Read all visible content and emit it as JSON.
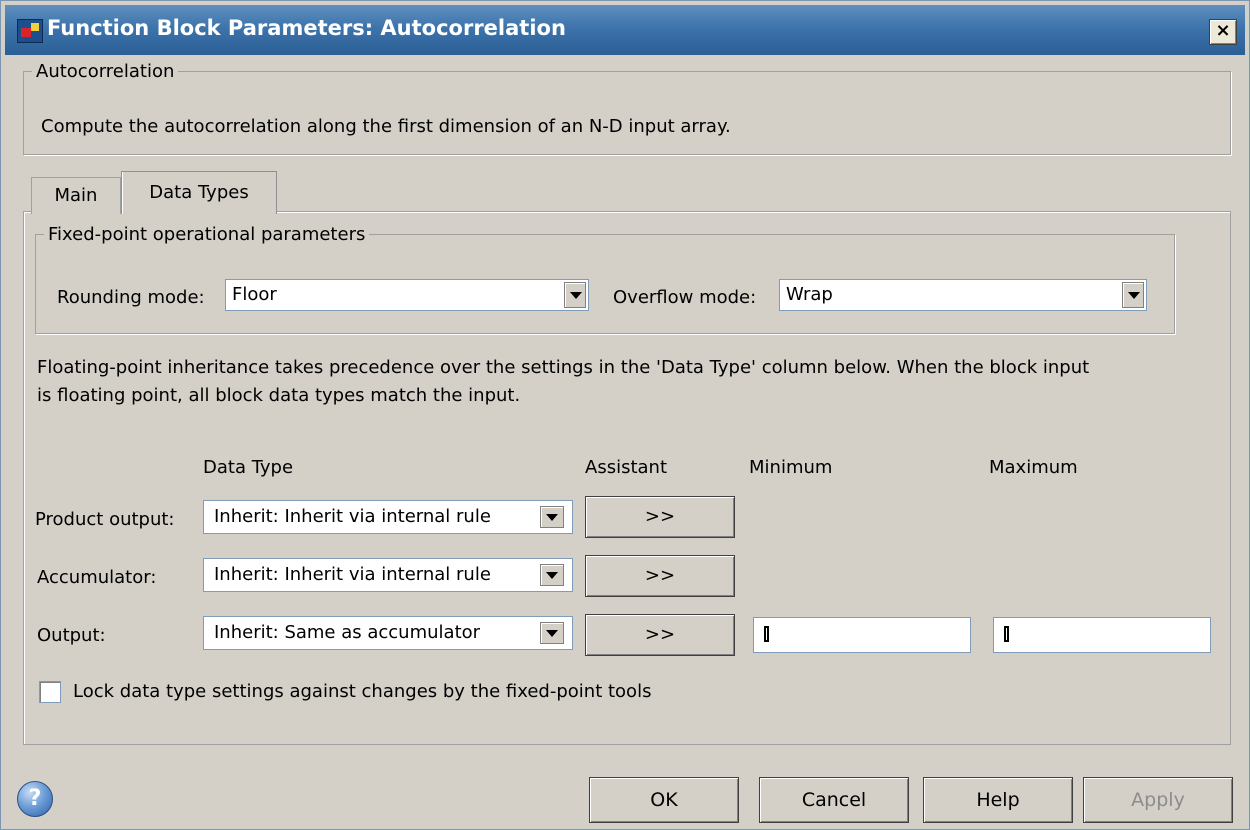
{
  "window": {
    "title": "Function Block Parameters: Autocorrelation",
    "close_label": "×"
  },
  "description": {
    "legend": "Autocorrelation",
    "text": "Compute the autocorrelation along the first dimension of an N-D input array."
  },
  "tabs": [
    {
      "label": "Main"
    },
    {
      "label": "Data Types",
      "selected": true
    }
  ],
  "fixed_point": {
    "legend": "Fixed-point operational parameters",
    "rounding_label": "Rounding mode:",
    "rounding_value": "Floor",
    "overflow_label": "Overflow mode:",
    "overflow_value": "Wrap"
  },
  "note": {
    "line1": "Floating-point inheritance takes precedence over the settings in the 'Data Type' column below. When the block input",
    "line2": "is floating point, all block data types match the input."
  },
  "table": {
    "headers": {
      "data_type": "Data Type",
      "assistant": "Assistant",
      "minimum": "Minimum",
      "maximum": "Maximum"
    },
    "rows": [
      {
        "label": "Product output:",
        "data_type": "Inherit: Inherit via internal rule",
        "assistant": ">>"
      },
      {
        "label": "Accumulator:",
        "data_type": "Inherit: Inherit via internal rule",
        "assistant": ">>"
      },
      {
        "label": "Output:",
        "data_type": "Inherit: Same as accumulator",
        "assistant": ">>",
        "minimum": "[]",
        "maximum": "[]"
      }
    ]
  },
  "lock": {
    "label": "Lock data type settings against changes by the fixed-point tools",
    "checked": false
  },
  "footer": {
    "help_icon": "?",
    "ok": "OK",
    "cancel": "Cancel",
    "help": "Help",
    "apply": "Apply"
  },
  "icons": {
    "app": "simulink-block-icon",
    "help": "help-question-icon"
  }
}
